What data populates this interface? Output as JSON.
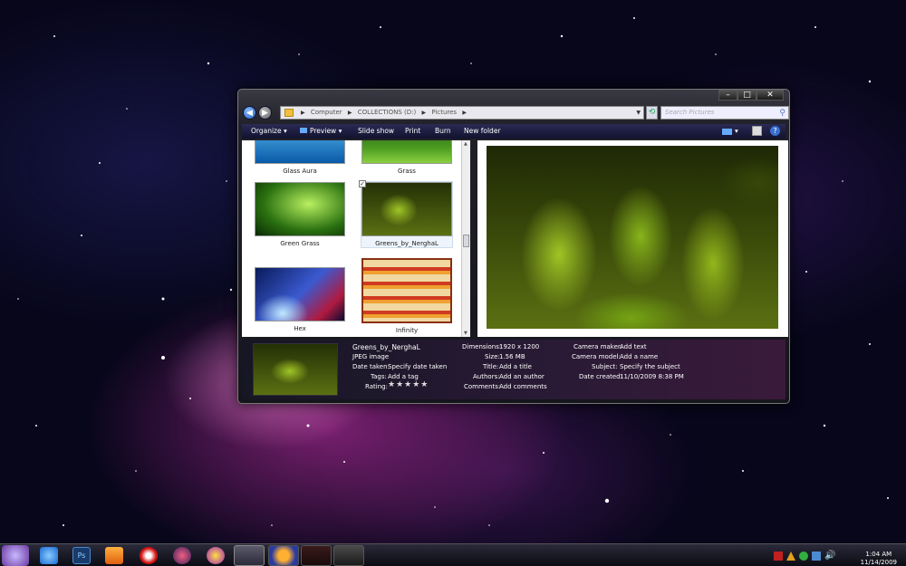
{
  "window": {
    "controls": {
      "minimize": "–",
      "maximize": "□",
      "close": "✕"
    },
    "address": {
      "crumbs": [
        "Computer",
        "COLLECTIONS (D:)",
        "Pictures"
      ],
      "search_placeholder": "Search Pictures"
    },
    "toolbar": {
      "organize": "Organize",
      "preview": "Preview",
      "slideshow": "Slide show",
      "print": "Print",
      "burn": "Burn",
      "new_folder": "New folder"
    },
    "files": [
      {
        "label": "Glass Aura"
      },
      {
        "label": "Grass"
      },
      {
        "label": "Green Grass"
      },
      {
        "label": "Greens_by_NerghaL",
        "selected": true
      },
      {
        "label": "Hex"
      },
      {
        "label": "Infinity"
      }
    ],
    "details": {
      "name": "Greens_by_NerghaL",
      "type": "JPEG image",
      "date_taken_label": "Date taken:",
      "date_taken_value": "Specify date taken",
      "tags_label": "Tags:",
      "tags_value": "Add a tag",
      "rating_label": "Rating:",
      "rating_value": "★★★★★",
      "dimensions_label": "Dimensions:",
      "dimensions_value": "1920 x 1200",
      "size_label": "Size:",
      "size_value": "1.56 MB",
      "title_label": "Title:",
      "title_value": "Add a title",
      "authors_label": "Authors:",
      "authors_value": "Add an author",
      "comments_label": "Comments:",
      "comments_value": "Add comments",
      "camera_maker_label": "Camera maker:",
      "camera_maker_value": "Add text",
      "camera_model_label": "Camera model:",
      "camera_model_value": "Add a name",
      "subject_label": "Subject:",
      "subject_value": "Specify the subject",
      "date_created_label": "Date created:",
      "date_created_value": "11/10/2009 8:38 PM"
    }
  },
  "taskbar": {
    "time": "1:04 AM",
    "date": "11/14/2009",
    "icons": [
      "internet-explorer-icon",
      "photoshop-icon",
      "media-player-icon",
      "ball-icon",
      "gem-icon",
      "messenger-icon",
      "explorer-icon",
      "firefox-icon",
      "app-icon",
      "game-icon"
    ]
  },
  "colors": {
    "toolbar_bg": "#1c1c40",
    "details_bg": "#2a1a36",
    "accent_blue": "#1c5bb5"
  }
}
